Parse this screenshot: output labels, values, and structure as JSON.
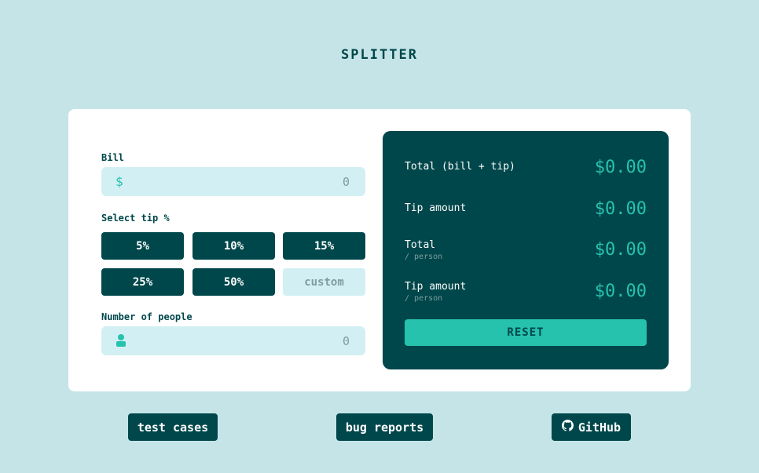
{
  "app": {
    "title": "SPLITTER"
  },
  "bill": {
    "label": "Bill",
    "icon": "dollar-icon",
    "currency": "$",
    "value": "0"
  },
  "tip": {
    "label": "Select tip %",
    "options": [
      "5%",
      "10%",
      "15%",
      "25%",
      "50%"
    ],
    "custom_placeholder": "custom"
  },
  "people": {
    "label": "Number of people",
    "icon": "person-icon",
    "value": "0"
  },
  "results": {
    "rows": [
      {
        "label": "Total (bill + tip)",
        "sub": "",
        "value": "$0.00"
      },
      {
        "label": "Tip amount",
        "sub": "",
        "value": "$0.00"
      },
      {
        "label": "Total",
        "sub": "/ person",
        "value": "$0.00"
      },
      {
        "label": "Tip amount",
        "sub": "/ person",
        "value": "$0.00"
      }
    ],
    "reset_label": "RESET"
  },
  "footer": {
    "links": [
      {
        "label": "test cases"
      },
      {
        "label": "bug reports"
      },
      {
        "label": "GitHub",
        "icon": "github-icon"
      }
    ]
  },
  "colors": {
    "background": "#c5e4e7",
    "dark_teal": "#00474b",
    "accent": "#26c2ad",
    "input_bg": "#d2f0f3",
    "muted": "#7f9d9f"
  }
}
